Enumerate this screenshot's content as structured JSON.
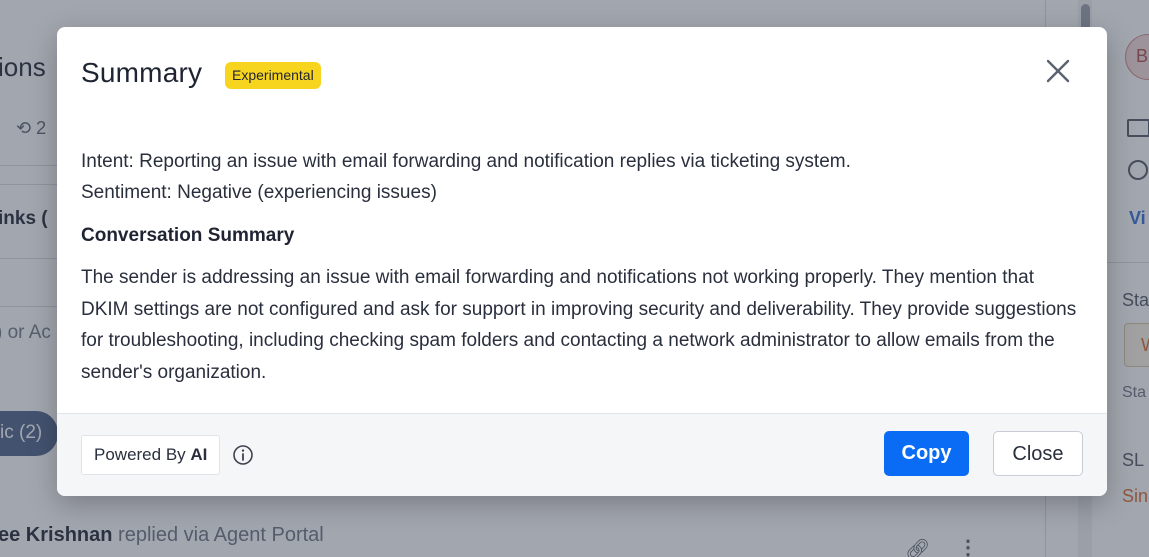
{
  "background": {
    "title_fragment": "ions",
    "history_count": "2",
    "links_fragment": "inks (",
    "placeholder_fragment": ") or Ac",
    "pill_label": "ic (2)",
    "replier_name": "ee Krishnan",
    "replier_action": "replied via Agent Portal",
    "avatar_letter": "B",
    "right_link_fragment": "Vi",
    "status_fragment": "Sta",
    "status_button_fragment": "W",
    "status_sub_fragment": "Sta",
    "sla_fragment": "SL",
    "sla_value_fragment": "Sin"
  },
  "modal": {
    "title": "Summary",
    "badge": "Experimental",
    "intent": "Intent: Reporting an issue with email forwarding and notification replies via ticketing system.",
    "sentiment": "Sentiment: Negative (experiencing issues)",
    "section_heading": "Conversation Summary",
    "summary_text": "The sender is addressing an issue with email forwarding and notifications not working properly. They mention that DKIM settings are not configured and ask for support in improving security and deliverability. They provide suggestions for troubleshooting, including checking spam folders and contacting a network administrator to allow emails from the sender's organization.",
    "powered_by_prefix": "Powered By",
    "powered_by_brand": "AI",
    "copy_label": "Copy",
    "close_label": "Close"
  },
  "colors": {
    "badge": "#f7d51f",
    "primary_button": "#0a6cf5",
    "overlay": "rgba(60, 68, 85, 0.48)"
  },
  "icons": [
    "history-icon",
    "close-icon",
    "info-icon",
    "link-icon",
    "more-vertical-icon",
    "mail-icon",
    "clock-icon"
  ]
}
